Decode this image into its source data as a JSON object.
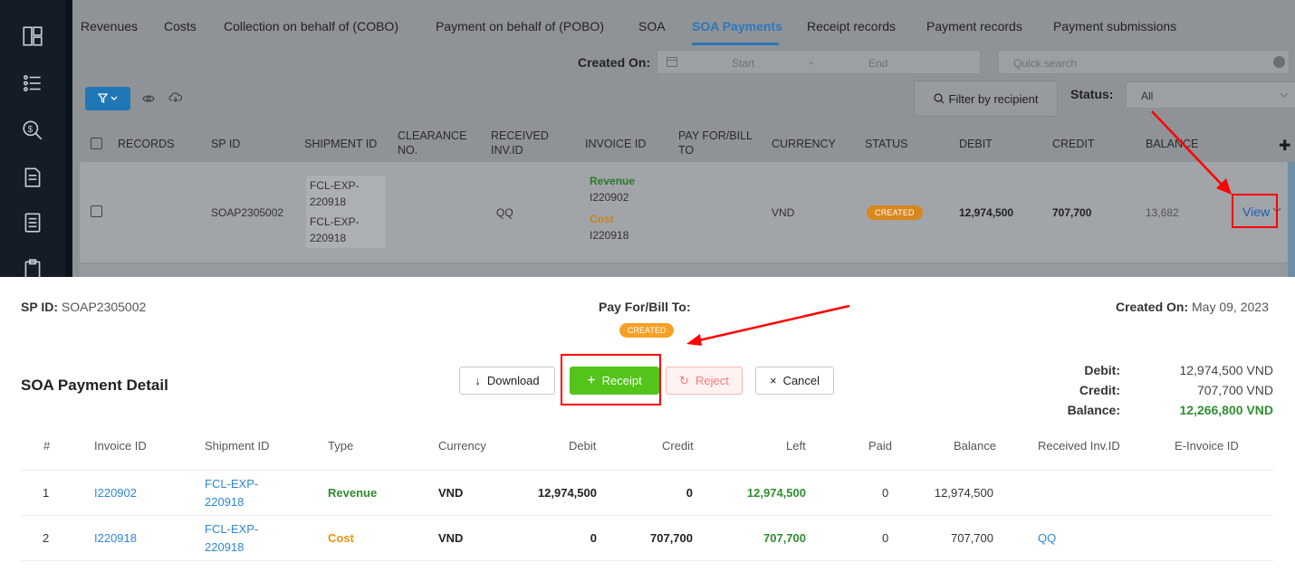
{
  "tabs": [
    "Revenues",
    "Costs",
    "Collection on behalf of (COBO)",
    "Payment on behalf of (POBO)",
    "SOA",
    "SOA Payments",
    "Receipt records",
    "Payment records",
    "Payment submissions"
  ],
  "active_tab": "SOA Payments",
  "filters": {
    "created_on_label": "Created On:",
    "start_placeholder": "Start",
    "range_dash": "-",
    "end_placeholder": "End",
    "quick_search_placeholder": "Quick search",
    "filter_by_recipient": "Filter by recipient",
    "status_label": "Status:",
    "status_value": "All"
  },
  "list": {
    "columns": [
      "RECORDS",
      "SP ID",
      "SHIPMENT ID",
      "CLEARANCE NO.",
      "RECEIVED INV.ID",
      "INVOICE ID",
      "PAY FOR/BILL TO",
      "CURRENCY",
      "STATUS",
      "DEBIT",
      "CREDIT",
      "BALANCE"
    ],
    "row": {
      "sp_id": "SOAP2305002",
      "shipments": [
        "FCL-EXP-220918",
        "FCL-EXP-220918"
      ],
      "received_inv_id": "QQ",
      "revenue_label": "Revenue",
      "revenue_invoice": "I220902",
      "cost_label": "Cost",
      "cost_invoice": "I220918",
      "currency": "VND",
      "status": "CREATED",
      "debit": "12,974,500",
      "credit": "707,700",
      "balance": "13,682",
      "action": "View"
    }
  },
  "detail": {
    "sp_id_label": "SP ID:",
    "sp_id": "SOAP2305002",
    "pay_for_label": "Pay For/Bill To:",
    "status": "CREATED",
    "created_on_label": "Created On:",
    "created_on": "May 09, 2023",
    "title": "SOA Payment Detail",
    "buttons": {
      "download": "Download",
      "receipt": "Receipt",
      "reject": "Reject",
      "cancel": "Cancel"
    },
    "summary": {
      "debit_label": "Debit:",
      "debit": "12,974,500 VND",
      "credit_label": "Credit:",
      "credit": "707,700 VND",
      "balance_label": "Balance:",
      "balance": "12,266,800 VND"
    },
    "columns": [
      "#",
      "Invoice ID",
      "Shipment ID",
      "Type",
      "Currency",
      "Debit",
      "Credit",
      "Left",
      "Paid",
      "Balance",
      "Received Inv.ID",
      "E-Invoice ID"
    ],
    "rows": [
      {
        "n": "1",
        "invoice": "I220902",
        "shipment_a": "FCL-EXP-",
        "shipment_b": "220918",
        "type": "Revenue",
        "currency": "VND",
        "debit": "12,974,500",
        "credit": "0",
        "left": "12,974,500",
        "paid": "0",
        "balance": "12,974,500",
        "received": ""
      },
      {
        "n": "2",
        "invoice": "I220918",
        "shipment_a": "FCL-EXP-",
        "shipment_b": "220918",
        "type": "Cost",
        "currency": "VND",
        "debit": "0",
        "credit": "707,700",
        "left": "707,700",
        "paid": "0",
        "balance": "707,700",
        "received": "QQ"
      }
    ]
  },
  "colors": {
    "accent": "#2e77b8",
    "success": "#52c41a",
    "annotation": "#ff0000",
    "created_badge": "#f5a227"
  }
}
